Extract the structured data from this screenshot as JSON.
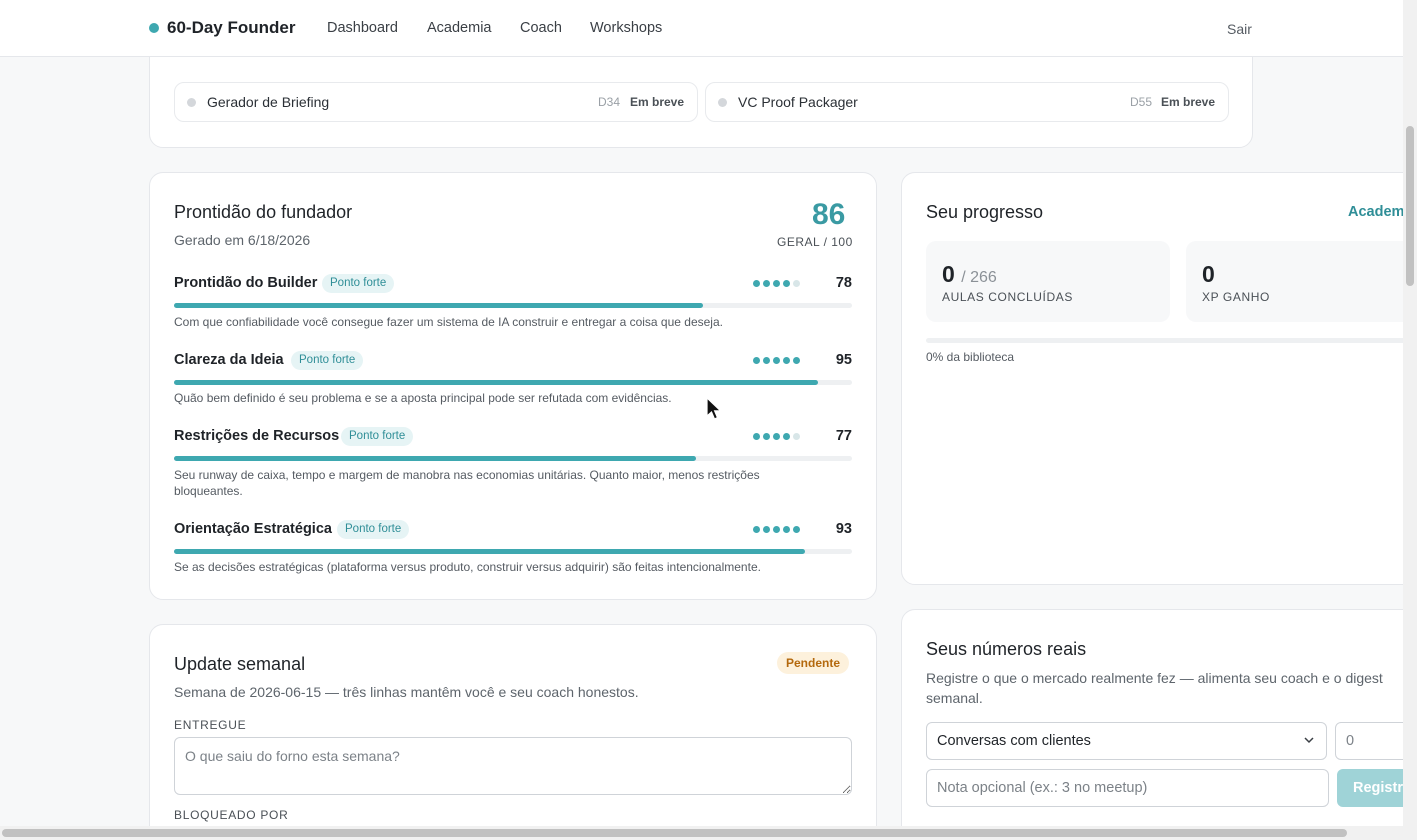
{
  "nav": {
    "brand": "60-Day Founder",
    "links": [
      "Dashboard",
      "Academia",
      "Coach",
      "Workshops"
    ],
    "exit": "Sair"
  },
  "tools": {
    "items": [
      {
        "name": "Gerador de Briefing",
        "day": "D34",
        "status": "Em breve"
      },
      {
        "name": "VC Proof Packager",
        "day": "D55",
        "status": "Em breve"
      }
    ]
  },
  "readiness": {
    "title": "Prontidão do fundador",
    "generated": "Gerado em 6/18/2026",
    "overall": "86",
    "overall_caption": "GERAL / 100",
    "metrics": [
      {
        "name": "Prontidão do Builder",
        "tag": "Ponto forte",
        "value": "78",
        "score": 78,
        "dots_on": 4,
        "description": "Com que confiabilidade você consegue fazer um sistema de IA construir e entregar a coisa que deseja."
      },
      {
        "name": "Clareza da Ideia",
        "tag": "Ponto forte",
        "value": "95",
        "score": 95,
        "dots_on": 5,
        "description": "Quão bem definido é seu problema e se a aposta principal pode ser refutada com evidências."
      },
      {
        "name": "Restrições de Recursos",
        "tag": "Ponto forte",
        "value": "77",
        "score": 77,
        "dots_on": 4,
        "description": "Seu runway de caixa, tempo e margem de manobra nas economias unitárias. Quanto maior, menos restrições bloqueantes."
      },
      {
        "name": "Orientação Estratégica",
        "tag": "Ponto forte",
        "value": "93",
        "score": 93,
        "dots_on": 5,
        "description": "Se as decisões estratégicas (plataforma versus produto, construir versus adquirir) são feitas intencionalmente."
      }
    ]
  },
  "progress": {
    "title": "Seu progresso",
    "link": "Academ",
    "lessons_done": "0",
    "lessons_total": "/ 266",
    "lessons_caption": "AULAS CONCLUÍDAS",
    "xp": "0",
    "xp_caption": "XP GANHO",
    "library_pct": "0% da biblioteca",
    "library_fraction": 0
  },
  "weekly": {
    "title": "Update semanal",
    "badge": "Pendente",
    "subtitle": "Semana de 2026-06-15 — três linhas mantêm você e seu coach honestos.",
    "delivered_label": "ENTREGUE",
    "delivered_placeholder": "O que saiu do forno esta semana?",
    "blocked_label": "BLOQUEADO POR"
  },
  "numbers": {
    "title": "Seus números reais",
    "subtitle": "Registre o que o mercado realmente fez — alimenta seu coach e o digest semanal.",
    "select_value": "Conversas com clientes",
    "count_placeholder": "0",
    "note_placeholder": "Nota opcional (ex.: 3 no meetup)",
    "button": "Registr"
  },
  "colors": {
    "accent": "#3ea8b0",
    "pending": "#b4690e"
  }
}
